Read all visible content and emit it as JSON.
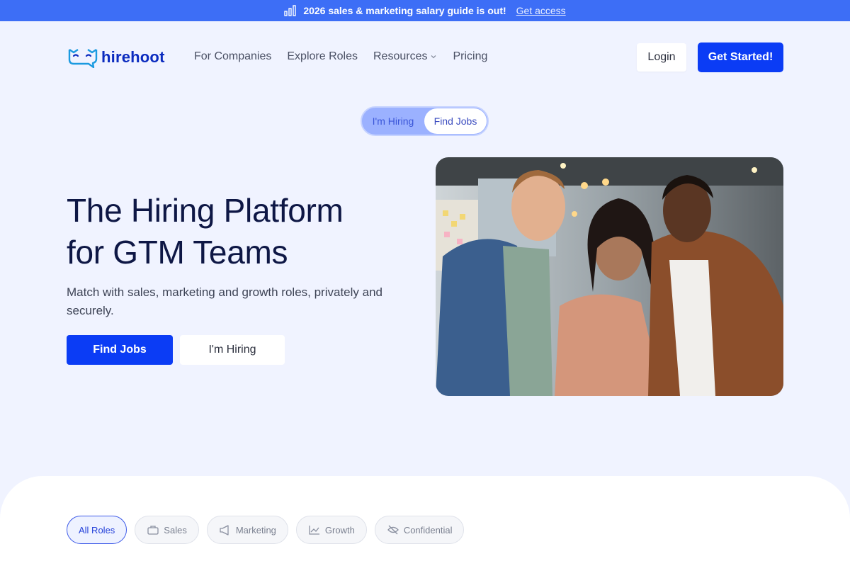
{
  "announcement": {
    "message": "2026 sales & marketing salary guide is out!",
    "link_label": "Get access",
    "icon": "bar-chart-icon"
  },
  "header": {
    "brand": "hirehoot",
    "nav": [
      {
        "label": "For Companies"
      },
      {
        "label": "Explore Roles"
      },
      {
        "label": "Resources",
        "has_dropdown": true
      },
      {
        "label": "Pricing"
      }
    ],
    "login_label": "Login",
    "cta_label": "Get Started!"
  },
  "toggle": {
    "options": [
      "I'm Hiring",
      "Find Jobs"
    ],
    "selected": "Find Jobs"
  },
  "hero": {
    "title_line1": "The Hiring Platform",
    "title_line2": "for GTM Teams",
    "subtitle": "Match with sales, marketing and growth roles, privately and securely.",
    "primary_button": "Find Jobs",
    "secondary_button": "I'm Hiring"
  },
  "filters": {
    "chips": [
      {
        "label": "All Roles",
        "icon": "",
        "active": true
      },
      {
        "label": "Sales",
        "icon": "briefcase-icon",
        "active": false
      },
      {
        "label": "Marketing",
        "icon": "megaphone-icon",
        "active": false
      },
      {
        "label": "Growth",
        "icon": "trend-icon",
        "active": false
      },
      {
        "label": "Confidential",
        "icon": "eye-off-icon",
        "active": false
      }
    ]
  },
  "colors": {
    "accent": "#0b3cf5",
    "announcement_bg": "#3d6ef6",
    "page_bg": "#f0f3ff",
    "title": "#0e1745"
  }
}
